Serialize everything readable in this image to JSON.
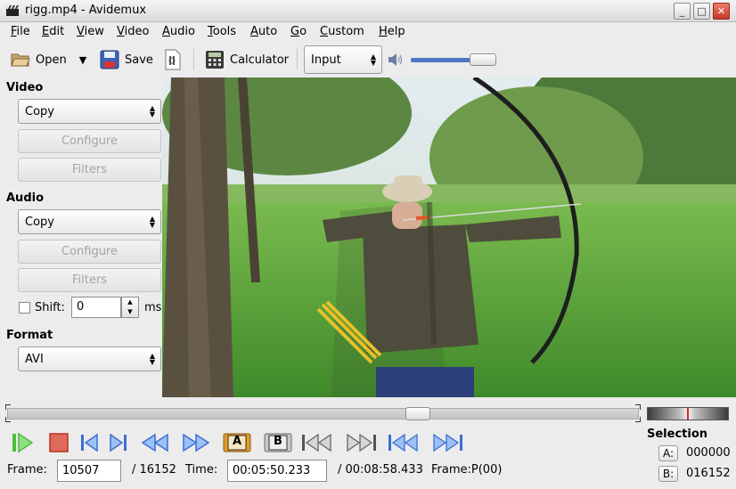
{
  "window": {
    "title": "rigg.mp4 - Avidemux",
    "minimize": "_",
    "maximize": "□",
    "close": "✕"
  },
  "menu": [
    "File",
    "Edit",
    "View",
    "Video",
    "Audio",
    "Tools",
    "Auto",
    "Go",
    "Custom",
    "Help"
  ],
  "toolbar": {
    "open_label": "Open",
    "save_label": "Save",
    "calculator_label": "Calculator",
    "input_combo": "Input",
    "volume_level": 0.85
  },
  "sidebar": {
    "video": {
      "heading": "Video",
      "codec": "Copy",
      "configure": "Configure",
      "filters": "Filters"
    },
    "audio": {
      "heading": "Audio",
      "codec": "Copy",
      "configure": "Configure",
      "filters": "Filters",
      "shift_label": "Shift:",
      "shift_value": "0",
      "shift_unit": "ms"
    },
    "format": {
      "heading": "Format",
      "container": "AVI"
    }
  },
  "timeline": {
    "position_fraction": 0.65
  },
  "controls": {
    "marker_a": "A",
    "marker_b": "B"
  },
  "info": {
    "frame_label": "Frame:",
    "frame_value": "10507",
    "frame_total": "/ 16152",
    "time_label": "Time:",
    "time_value": "00:05:50.233",
    "time_total": "/ 00:08:58.433",
    "frame_type": "Frame:P(00)"
  },
  "selection": {
    "heading": "Selection",
    "a_label": "A:",
    "a_value": "000000",
    "b_label": "B:",
    "b_value": "016152"
  },
  "colors": {
    "play": "#4bbf3a",
    "stop": "#d83a2a",
    "nav_blue": "#3a6fd6",
    "accent_orange": "#e39b2d"
  }
}
